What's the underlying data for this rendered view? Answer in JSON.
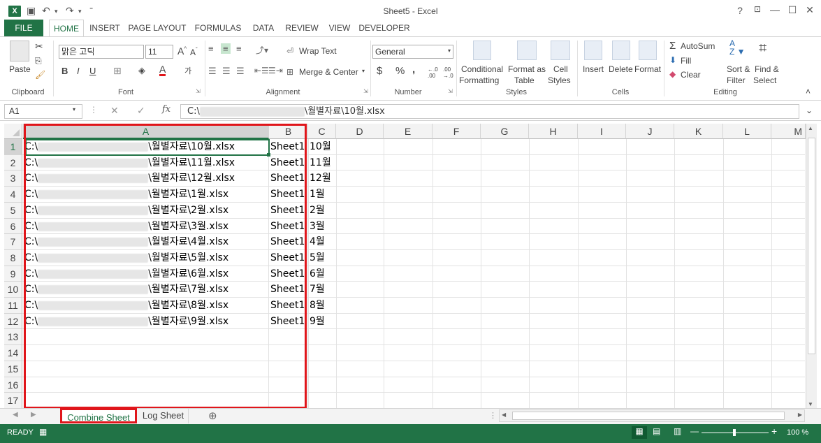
{
  "window": {
    "title": "Sheet5 - Excel",
    "app_icon": "X",
    "help": "?",
    "ribbon_display": "⊼",
    "minimize": "—",
    "maximize": "☐",
    "close": "✕"
  },
  "qat": {
    "save": "💾",
    "undo": "↶",
    "redo": "↷",
    "customize": "⁼"
  },
  "tabs": [
    "FILE",
    "HOME",
    "INSERT",
    "PAGE LAYOUT",
    "FORMULAS",
    "DATA",
    "REVIEW",
    "VIEW",
    "DEVELOPER"
  ],
  "ribbon": {
    "clipboard": {
      "paste": "Paste",
      "label": "Clipboard"
    },
    "font": {
      "name": "맑은 고딕",
      "size": "11",
      "bold": "B",
      "italic": "I",
      "underline": "U",
      "grow": "A˄",
      "shrink": "A˅",
      "label": "Font",
      "color_letter": "A",
      "phonetic": "가"
    },
    "alignment": {
      "wrap": "Wrap Text",
      "merge": "Merge & Center",
      "label": "Alignment"
    },
    "number": {
      "format": "General",
      "currency": "$",
      "percent": "%",
      "comma": ",",
      "inc": "←.0 .00",
      "dec": ".00 →.0",
      "label": "Number"
    },
    "styles": {
      "conditional": "Conditional",
      "conditional2": "Formatting",
      "format_as": "Format as",
      "format_as2": "Table",
      "cell": "Cell",
      "cell2": "Styles",
      "label": "Styles"
    },
    "cells": {
      "insert": "Insert",
      "delete": "Delete",
      "format": "Format",
      "label": "Cells"
    },
    "editing": {
      "autosum": "AutoSum",
      "fill": "Fill",
      "clear": "Clear",
      "sort": "Sort &",
      "sort2": "Filter",
      "find": "Find &",
      "find2": "Select",
      "label": "Editing"
    }
  },
  "formula_bar": {
    "name_box": "A1",
    "cancel": "✕",
    "enter": "✓",
    "fx": "fx",
    "prefix": "C:\\",
    "suffix": "\\월별자료\\10월.xlsx"
  },
  "columns": [
    "A",
    "B",
    "C",
    "D",
    "E",
    "F",
    "G",
    "H",
    "I",
    "J",
    "K",
    "L",
    "M"
  ],
  "rows": [
    {
      "n": "1",
      "a_pre": "C:\\",
      "a_suf": "\\월별자료\\10월.xlsx",
      "b": "Sheet1",
      "c": "10월"
    },
    {
      "n": "2",
      "a_pre": "C:\\",
      "a_suf": "\\월별자료\\11월.xlsx",
      "b": "Sheet1",
      "c": "11월"
    },
    {
      "n": "3",
      "a_pre": "C:\\",
      "a_suf": "\\월별자료\\12월.xlsx",
      "b": "Sheet1",
      "c": "12월"
    },
    {
      "n": "4",
      "a_pre": "C:\\",
      "a_suf": "\\월별자료\\1월.xlsx",
      "b": "Sheet1",
      "c": "1월"
    },
    {
      "n": "5",
      "a_pre": "C:\\",
      "a_suf": "\\월별자료\\2월.xlsx",
      "b": "Sheet1",
      "c": "2월"
    },
    {
      "n": "6",
      "a_pre": "C:\\",
      "a_suf": "\\월별자료\\3월.xlsx",
      "b": "Sheet1",
      "c": "3월"
    },
    {
      "n": "7",
      "a_pre": "C:\\",
      "a_suf": "\\월별자료\\4월.xlsx",
      "b": "Sheet1",
      "c": "4월"
    },
    {
      "n": "8",
      "a_pre": "C:\\",
      "a_suf": "\\월별자료\\5월.xlsx",
      "b": "Sheet1",
      "c": "5월"
    },
    {
      "n": "9",
      "a_pre": "C:\\",
      "a_suf": "\\월별자료\\6월.xlsx",
      "b": "Sheet1",
      "c": "6월"
    },
    {
      "n": "10",
      "a_pre": "C:\\",
      "a_suf": "\\월별자료\\7월.xlsx",
      "b": "Sheet1",
      "c": "7월"
    },
    {
      "n": "11",
      "a_pre": "C:\\",
      "a_suf": "\\월별자료\\8월.xlsx",
      "b": "Sheet1",
      "c": "8월"
    },
    {
      "n": "12",
      "a_pre": "C:\\",
      "a_suf": "\\월별자료\\9월.xlsx",
      "b": "Sheet1",
      "c": "9월"
    },
    {
      "n": "13",
      "a_pre": "",
      "a_suf": "",
      "b": "",
      "c": ""
    },
    {
      "n": "14",
      "a_pre": "",
      "a_suf": "",
      "b": "",
      "c": ""
    },
    {
      "n": "15",
      "a_pre": "",
      "a_suf": "",
      "b": "",
      "c": ""
    },
    {
      "n": "16",
      "a_pre": "",
      "a_suf": "",
      "b": "",
      "c": ""
    },
    {
      "n": "17",
      "a_pre": "",
      "a_suf": "",
      "b": "",
      "c": ""
    }
  ],
  "sheets": [
    "Combine Sheet",
    "Log Sheet"
  ],
  "add_sheet": "⊕",
  "status": {
    "ready": "READY",
    "zoom": "100 %",
    "zoom_minus": "—",
    "zoom_plus": "+"
  },
  "colors": {
    "accent": "#217346",
    "highlight": "#e0161b"
  }
}
